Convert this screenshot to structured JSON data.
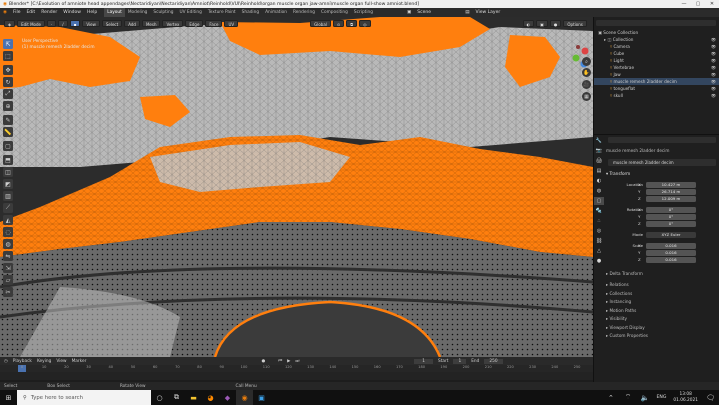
{
  "window": {
    "title": "Blender* [C:\\Evolution of amniote head appendages\\Nectaridiyan\\Nectaridiyan\\Amniot\\Reinhold\\VUI\\Reinhold\\organ muscle organ jaw-amni\\muscle organ full-show amniot.blend]",
    "controls": [
      "—",
      "▢",
      "✕"
    ]
  },
  "menu": {
    "items": [
      "File",
      "Edit",
      "Render",
      "Window",
      "Help"
    ],
    "workspaces": [
      "Layout",
      "Modeling",
      "Sculpting",
      "UV Editing",
      "Texture Paint",
      "Shading",
      "Animation",
      "Rendering",
      "Compositing",
      "Scripting"
    ],
    "active_workspace": "Layout",
    "scene_label": "Scene",
    "view_layer_label": "View Layer"
  },
  "viewport": {
    "mode": "Edit Mode",
    "header_menus": [
      "View",
      "Select",
      "Add",
      "Mesh",
      "Vertex",
      "Edge",
      "Face",
      "UV"
    ],
    "orientation": "Global",
    "overlay_title": "User Perspective",
    "overlay_object": "(1) muscle remesh 2ladder decim",
    "accent_color": "#ff7f0e",
    "options_label": "Options"
  },
  "toolbar_icons": [
    "cursor-icon",
    "select-box-icon",
    "move-icon",
    "rotate-icon",
    "scale-icon",
    "transform-icon",
    "annotate-icon",
    "measure-icon",
    "add-cube-icon",
    "extrude-icon",
    "inset-icon",
    "bevel-icon",
    "loop-cut-icon",
    "knife-icon",
    "poly-build-icon",
    "spin-icon",
    "smooth-icon",
    "edge-slide-icon",
    "shrink-icon",
    "shear-icon",
    "rip-icon"
  ],
  "timeline": {
    "menus": [
      "Playback",
      "Keying",
      "View",
      "Marker"
    ],
    "current_frame": "1",
    "start_label": "Start",
    "start_value": "1",
    "end_label": "End",
    "end_value": "250",
    "ticks": [
      "0",
      "10",
      "20",
      "30",
      "40",
      "50",
      "60",
      "70",
      "80",
      "90",
      "100",
      "110",
      "120",
      "130",
      "140",
      "150",
      "160",
      "170",
      "180",
      "190",
      "200",
      "210",
      "220",
      "230",
      "240",
      "250"
    ]
  },
  "status": {
    "items": [
      "Select",
      "Box Select",
      "Rotate View",
      "Call Menu"
    ]
  },
  "outliner": {
    "rows": [
      {
        "label": "Scene Collection",
        "indent": 0,
        "selected": false
      },
      {
        "label": "Collection",
        "indent": 1,
        "selected": false
      },
      {
        "label": "Camera",
        "indent": 2,
        "selected": false
      },
      {
        "label": "Cube",
        "indent": 2,
        "selected": false
      },
      {
        "label": "Light",
        "indent": 2,
        "selected": false
      },
      {
        "label": "Vertebrae",
        "indent": 2,
        "selected": false
      },
      {
        "label": "Jaw",
        "indent": 2,
        "selected": false
      },
      {
        "label": "muscle remesh 2ladder decim",
        "indent": 2,
        "selected": true
      },
      {
        "label": "tongueflat",
        "indent": 2,
        "selected": false
      },
      {
        "label": "skull",
        "indent": 2,
        "selected": false
      }
    ]
  },
  "properties": {
    "header_object": "muscle remesh 2ladder decim",
    "name_field": "muscle remesh 2ladder decim",
    "section": "Transform",
    "location_label": "Location",
    "location": [
      "10.427 m",
      "26.714 m",
      "12.009 m"
    ],
    "rotation_label": "Rotation",
    "rotation": [
      "0°",
      "0°",
      "0°"
    ],
    "mode_label": "Mode",
    "mode_value": "XYZ Euler",
    "scale_label": "Scale",
    "scale": [
      "0.016",
      "0.016",
      "0.016"
    ],
    "axis_labels": [
      "X",
      "Y",
      "Z"
    ],
    "panels": [
      "Delta Transform",
      "Relations",
      "Collections",
      "Instancing",
      "Motion Paths",
      "Visibility",
      "Viewport Display",
      "Custom Properties"
    ]
  },
  "taskbar": {
    "search_placeholder": "Type here to search",
    "language": "ENG",
    "time": "13:08",
    "date": "01.06.2021"
  }
}
